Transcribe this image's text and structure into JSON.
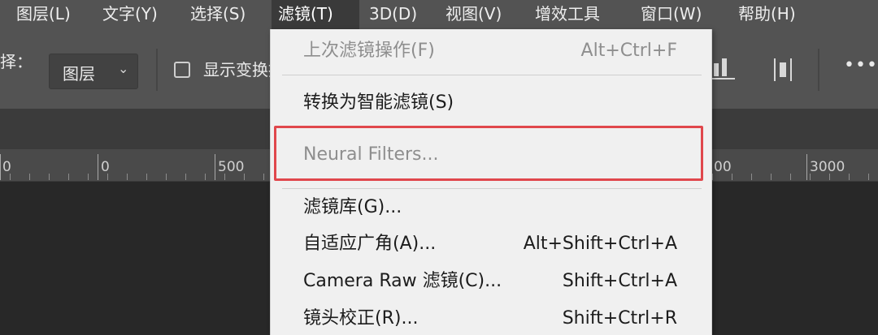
{
  "menubar": {
    "items": [
      "图层(L)",
      "文字(Y)",
      "选择(S)",
      "滤镜(T)",
      "3D(D)",
      "视图(V)",
      "增效工具",
      "窗口(W)",
      "帮助(H)"
    ],
    "active_index": 3
  },
  "options": {
    "select_label": "择：",
    "layer_dropdown": "图层",
    "show_transform_label": "显示变换控件"
  },
  "ruler": {
    "labels": [
      "0",
      "0",
      "500",
      "00",
      "3000"
    ]
  },
  "filter_menu": {
    "items": [
      {
        "label": "上次滤镜操作(F)",
        "shortcut": "Alt+Ctrl+F",
        "disabled": true
      },
      {
        "label": "转换为智能滤镜(S)",
        "shortcut": "",
        "disabled": false
      },
      {
        "label": "Neural Filters...",
        "shortcut": "",
        "disabled": true
      },
      {
        "label": "滤镜库(G)...",
        "shortcut": "",
        "disabled": false
      },
      {
        "label": "自适应广角(A)...",
        "shortcut": "Alt+Shift+Ctrl+A",
        "disabled": false
      },
      {
        "label": "Camera Raw 滤镜(C)...",
        "shortcut": "Shift+Ctrl+A",
        "disabled": false
      },
      {
        "label": "镜头校正(R)...",
        "shortcut": "Shift+Ctrl+R",
        "disabled": false
      }
    ],
    "highlight_color": "#e0474c"
  },
  "colors": {
    "menubar_bg": "#535353",
    "menu_bg": "#f0f0f0",
    "canvas_bg": "#282828"
  }
}
